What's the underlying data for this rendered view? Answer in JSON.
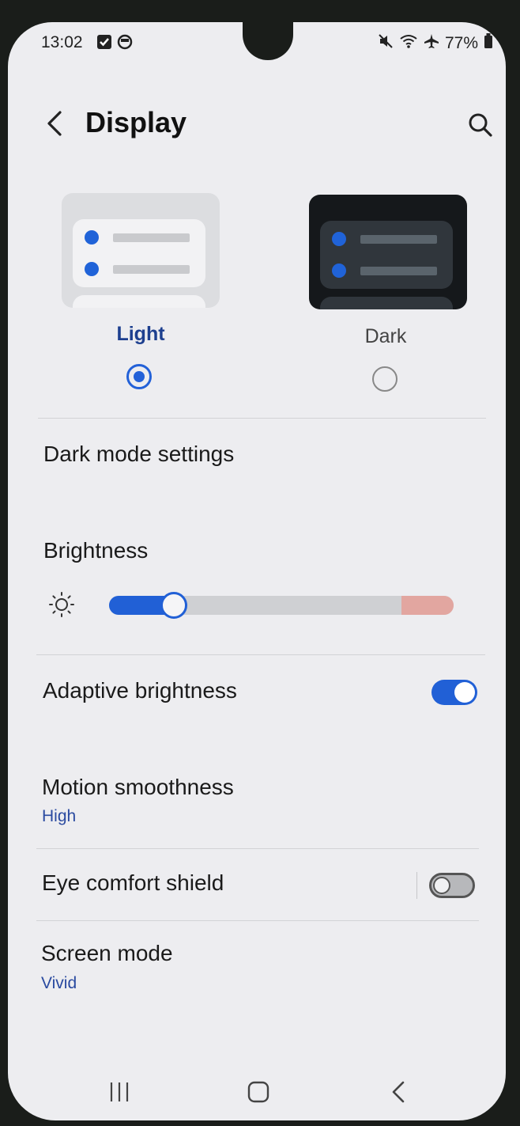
{
  "status_bar": {
    "time": "13:02",
    "battery": "77%",
    "icons": [
      "checkbox-notification-icon",
      "sync-notification-icon",
      "mute-icon",
      "wifi-icon",
      "airplane-icon",
      "battery-icon"
    ]
  },
  "header": {
    "title": "Display",
    "back_icon": "back-chevron-icon",
    "search_icon": "search-icon"
  },
  "theme": {
    "light_label": "Light",
    "dark_label": "Dark",
    "selected": "Light"
  },
  "rows": {
    "dark_mode_settings": "Dark mode settings",
    "brightness": "Brightness",
    "adaptive_brightness": "Adaptive brightness",
    "motion_smoothness": "Motion smoothness",
    "motion_smoothness_value": "High",
    "eye_comfort_shield": "Eye comfort shield",
    "screen_mode": "Screen mode",
    "screen_mode_value": "Vivid"
  },
  "brightness": {
    "level": 0.16
  },
  "toggles": {
    "adaptive_brightness": true,
    "eye_comfort_shield": false
  },
  "colors": {
    "accent": "#2160d6",
    "background": "#ededf0",
    "subtext": "#2a4aa0"
  },
  "navbar": {
    "icons": [
      "recents-icon",
      "home-icon",
      "back-icon"
    ]
  }
}
